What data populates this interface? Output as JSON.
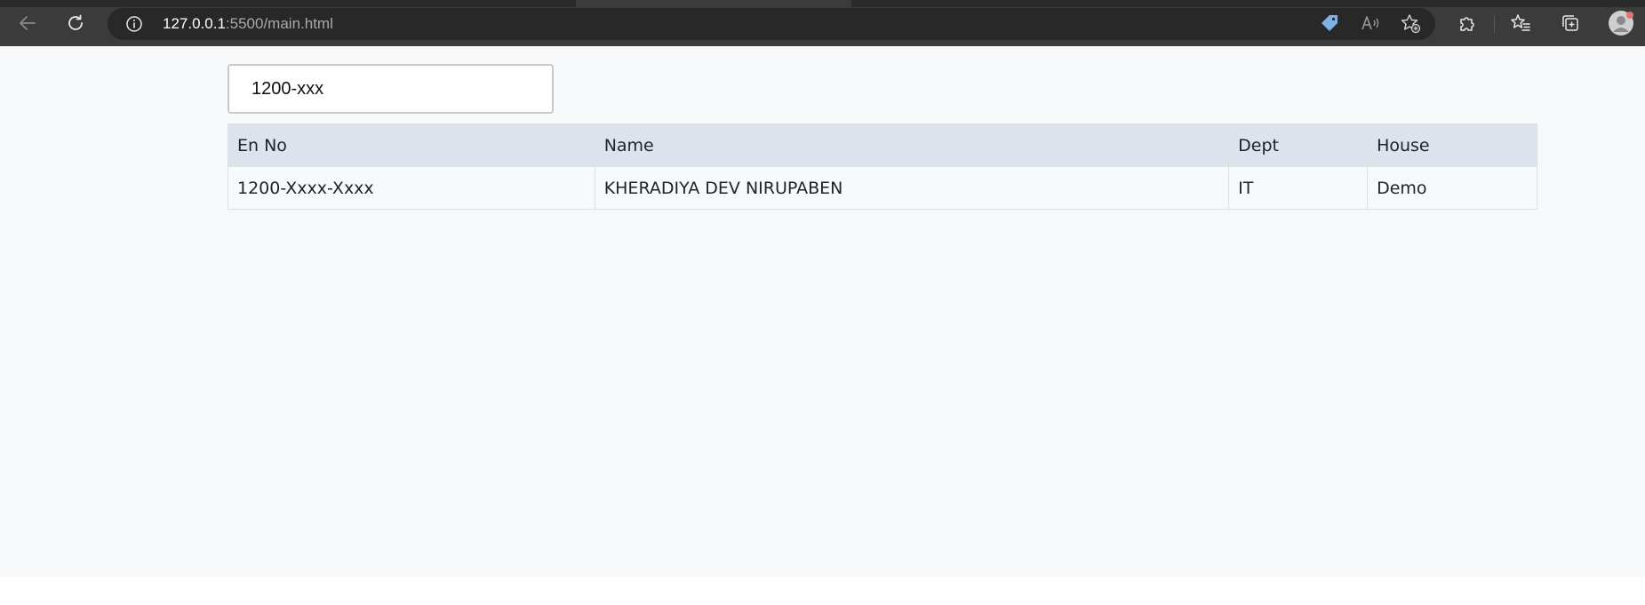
{
  "browser": {
    "url_host": "127.0.0.1",
    "url_path": ":5500/main.html",
    "icons": {
      "back": "back-arrow-icon",
      "reload": "reload-icon",
      "site_info": "info-icon",
      "coupon": "price-tag-icon",
      "read_aloud": "read-aloud-icon",
      "add_favorite": "add-favorite-icon",
      "extensions": "puzzle-icon",
      "favorites": "favorites-icon",
      "collections": "collections-icon",
      "profile": "profile-avatar-icon"
    },
    "colors": {
      "chrome": "#3b3b3b",
      "omnibox": "#282828",
      "coupon_accent": "#7fb3e6",
      "profile_badge": "#e57373"
    }
  },
  "search": {
    "value": "1200-xxx"
  },
  "table": {
    "columns": [
      "En No",
      "Name",
      "Dept",
      "House"
    ],
    "rows": [
      [
        "1200-Xxxx-Xxxx",
        "KHERADIYA DEV NIRUPABEN",
        "IT",
        "Demo"
      ]
    ]
  },
  "colors": {
    "page_background": "#f7f8fa",
    "header_background": "#dde3ec",
    "border": "#dde0e4"
  }
}
